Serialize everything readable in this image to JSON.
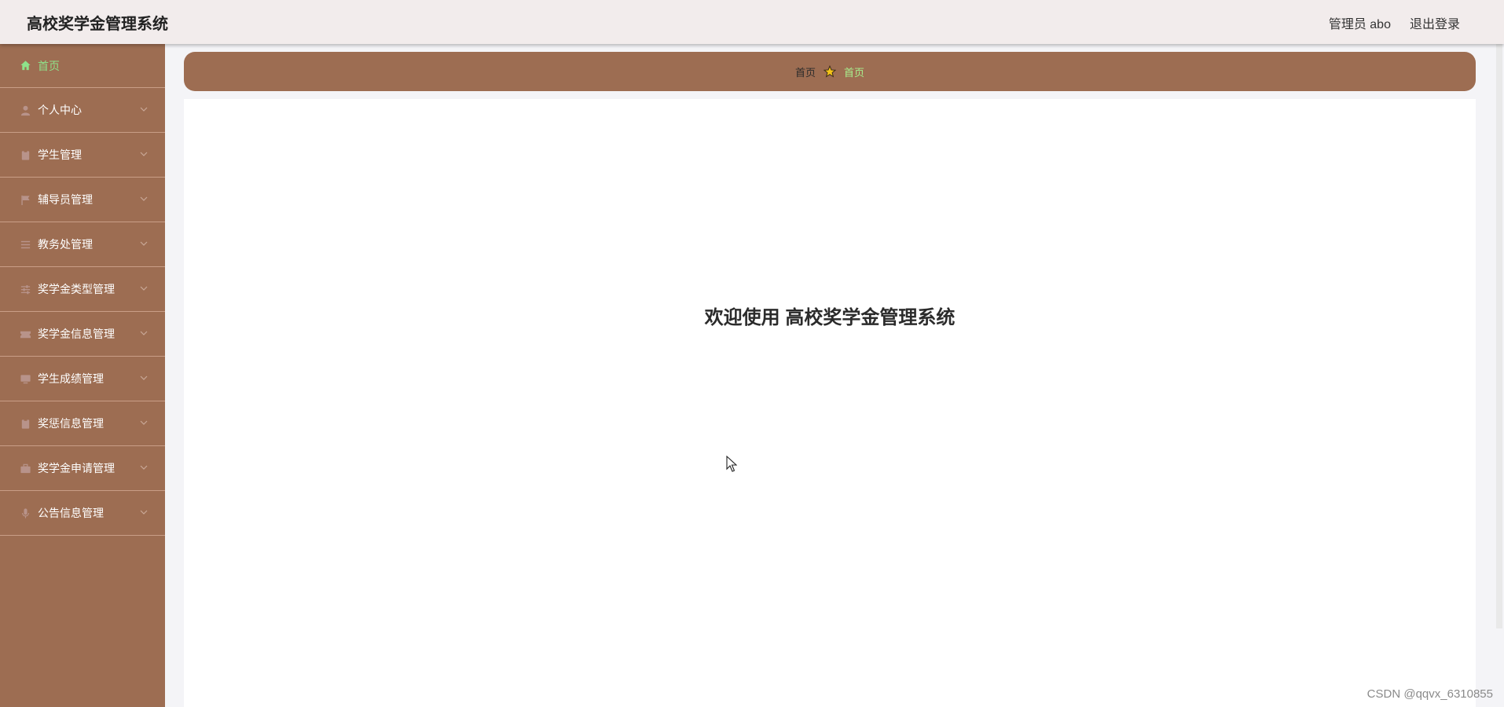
{
  "header": {
    "title": "高校奖学金管理系统",
    "user_label": "管理员 abo",
    "logout_label": "退出登录"
  },
  "sidebar": {
    "items": [
      {
        "label": "首页",
        "icon": "home-icon",
        "active": true
      },
      {
        "label": "个人中心",
        "icon": "user-icon"
      },
      {
        "label": "学生管理",
        "icon": "clipboard-icon"
      },
      {
        "label": "辅导员管理",
        "icon": "flag-icon"
      },
      {
        "label": "教务处管理",
        "icon": "list-icon"
      },
      {
        "label": "奖学金类型管理",
        "icon": "sliders-icon"
      },
      {
        "label": "奖学金信息管理",
        "icon": "ticket-icon"
      },
      {
        "label": "学生成绩管理",
        "icon": "monitor-icon"
      },
      {
        "label": "奖惩信息管理",
        "icon": "clipboard-icon"
      },
      {
        "label": "奖学金申请管理",
        "icon": "briefcase-icon"
      },
      {
        "label": "公告信息管理",
        "icon": "microphone-icon"
      }
    ]
  },
  "breadcrumb": {
    "home": "首页",
    "separator_icon": "star-icon",
    "current": "首页"
  },
  "main": {
    "welcome": "欢迎使用 高校奖学金管理系统"
  },
  "watermark": "CSDN @qqvx_6310855",
  "colors": {
    "sidebar_bg": "#9d6d52",
    "topbar_bg": "#f2ecec",
    "active_text": "#8ee28a",
    "crumb_current": "#a8f08e"
  }
}
